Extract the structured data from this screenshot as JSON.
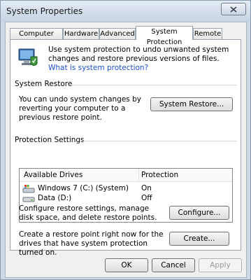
{
  "window": {
    "title": "System Properties"
  },
  "tabs": [
    {
      "label": "Computer Name"
    },
    {
      "label": "Hardware"
    },
    {
      "label": "Advanced"
    },
    {
      "label": "System Protection"
    },
    {
      "label": "Remote"
    }
  ],
  "intro": {
    "text": "Use system protection to undo unwanted system changes and restore previous versions of files.",
    "link": "What is system protection?"
  },
  "system_restore": {
    "heading": "System Restore",
    "description": "You can undo system changes by reverting your computer to a previous restore point.",
    "button": "System Restore..."
  },
  "protection_settings": {
    "heading": "Protection Settings",
    "columns": [
      "Available Drives",
      "Protection"
    ],
    "drives": [
      {
        "name": "Windows 7 (C:) (System)",
        "protection": "On",
        "icon": "system-drive-icon"
      },
      {
        "name": "Data (D:)",
        "protection": "Off",
        "icon": "drive-icon"
      }
    ],
    "configure_text": "Configure restore settings, manage disk space, and delete restore points.",
    "configure_button": "Configure...",
    "create_text": "Create a restore point right now for the drives that have system protection turned on.",
    "create_button": "Create..."
  },
  "footer": {
    "ok": "OK",
    "cancel": "Cancel",
    "apply": "Apply"
  }
}
